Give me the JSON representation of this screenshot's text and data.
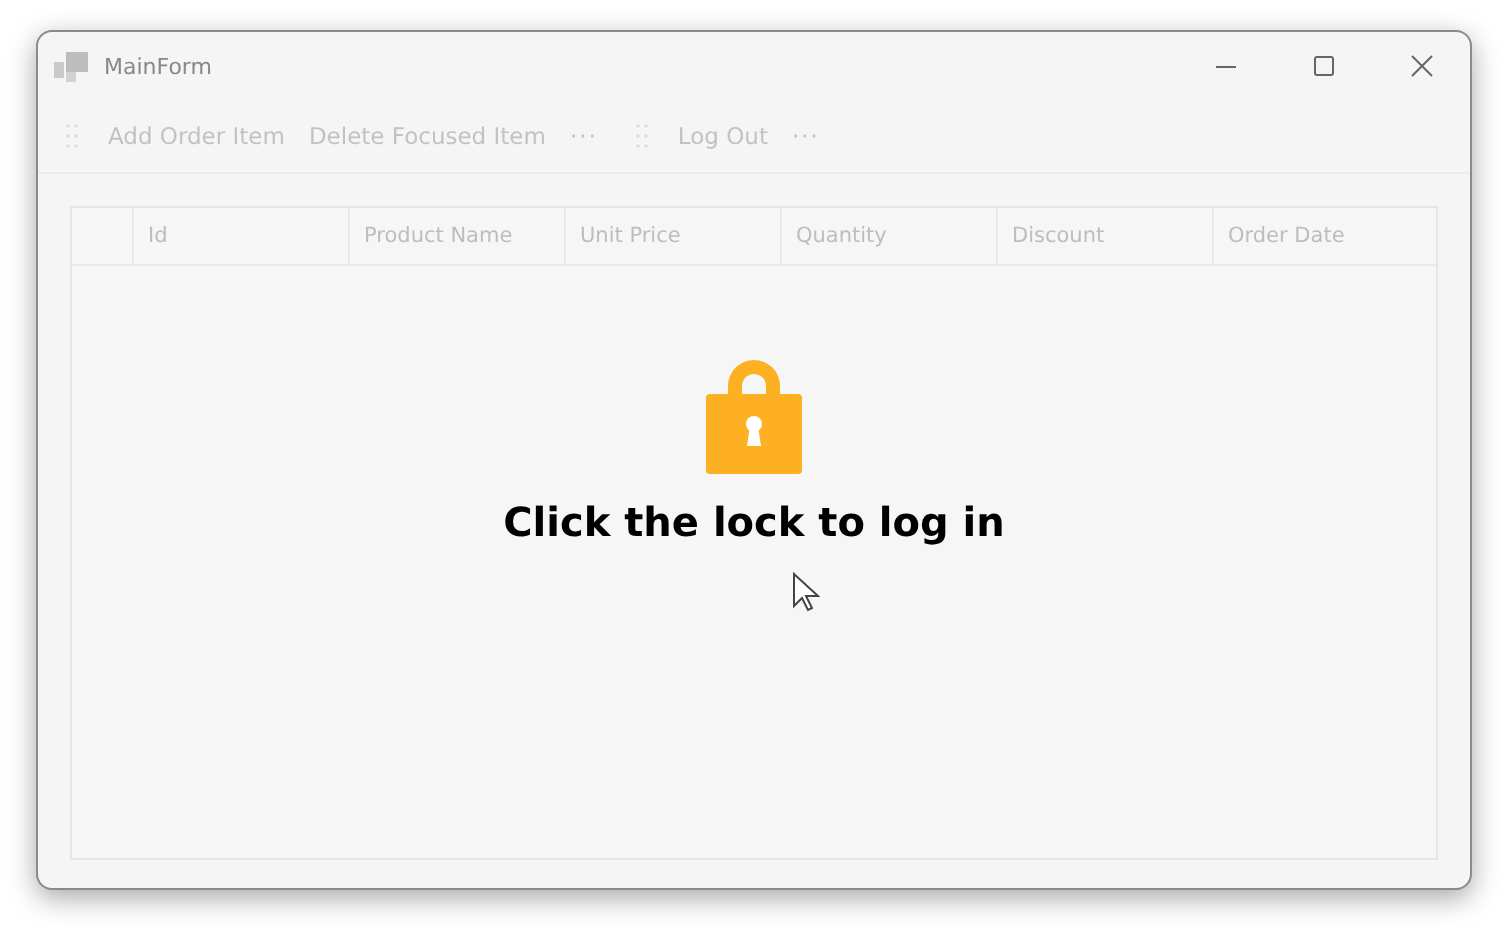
{
  "window": {
    "title": "MainForm"
  },
  "toolbar": {
    "groups": [
      {
        "items": [
          {
            "label": "Add Order Item",
            "disabled": true
          },
          {
            "label": "Delete Focused Item",
            "disabled": true
          }
        ],
        "overflow": "···"
      },
      {
        "items": [
          {
            "label": "Log Out",
            "disabled": true
          }
        ],
        "overflow": "···"
      }
    ]
  },
  "grid": {
    "columns": [
      {
        "label": "Id"
      },
      {
        "label": "Product Name"
      },
      {
        "label": "Unit Price"
      },
      {
        "label": "Quantity"
      },
      {
        "label": "Discount"
      },
      {
        "label": "Order Date"
      }
    ]
  },
  "overlay": {
    "message": "Click the lock to log in"
  }
}
